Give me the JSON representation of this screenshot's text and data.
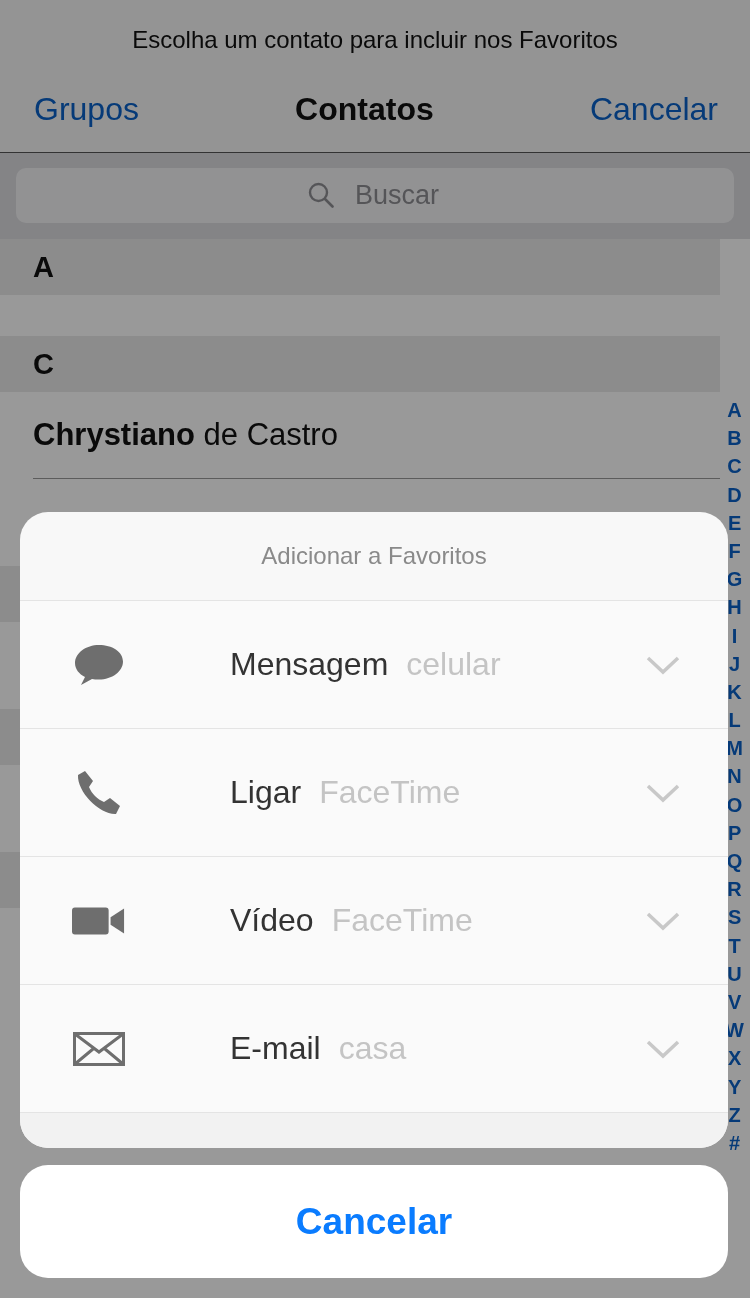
{
  "prompt": "Escolha um contato para incluir nos Favoritos",
  "nav": {
    "left": "Grupos",
    "title": "Contatos",
    "right": "Cancelar"
  },
  "search": {
    "placeholder": "Buscar"
  },
  "sections": [
    {
      "letter": "A"
    },
    {
      "letter": "C",
      "rows": [
        {
          "name": "**Chrystiano** de Castro"
        }
      ]
    }
  ],
  "index": [
    "A",
    "B",
    "C",
    "D",
    "E",
    "F",
    "G",
    "H",
    "I",
    "J",
    "K",
    "L",
    "M",
    "N",
    "O",
    "P",
    "Q",
    "R",
    "S",
    "T",
    "U",
    "V",
    "W",
    "X",
    "Y",
    "Z",
    "#"
  ],
  "sheet": {
    "title": "Adicionar a Favoritos",
    "options": [
      {
        "kind": "message",
        "label": "Mensagem",
        "detail": "celular"
      },
      {
        "kind": "call",
        "label": "Ligar",
        "detail": "FaceTime"
      },
      {
        "kind": "video",
        "label": "Vídeo",
        "detail": "FaceTime"
      },
      {
        "kind": "email",
        "label": "E-mail",
        "detail": "casa"
      }
    ],
    "cancel": "Cancelar"
  }
}
